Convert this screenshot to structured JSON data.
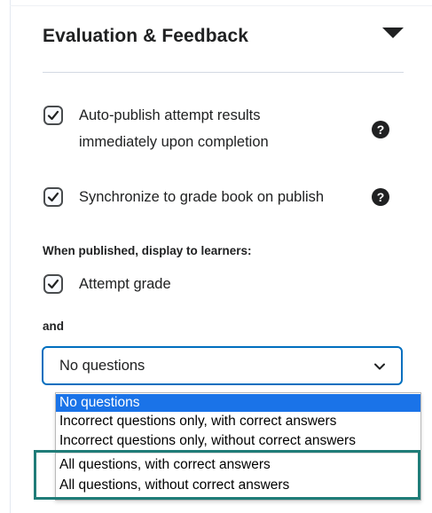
{
  "section": {
    "title": "Evaluation & Feedback"
  },
  "options": {
    "auto_publish": {
      "label_line1": "Auto-publish attempt results",
      "label_line2": "immediately upon completion",
      "checked": true
    },
    "sync_gradebook": {
      "label": "Synchronize to grade book on publish",
      "checked": true
    }
  },
  "display": {
    "heading": "When published, display to learners:",
    "attempt_grade": {
      "label": "Attempt grade",
      "checked": true
    },
    "and_label": "and"
  },
  "questions_select": {
    "value": "No questions",
    "options": [
      "No questions",
      "Incorrect questions only, with correct answers",
      "Incorrect questions only, without correct answers",
      "All questions, with correct answers",
      "All questions, without correct answers"
    ]
  },
  "help_icon_text": "?",
  "colors": {
    "select_border": "#006fbf",
    "option_selected_bg": "#1a73e8",
    "highlight_border": "#1f7c78"
  }
}
